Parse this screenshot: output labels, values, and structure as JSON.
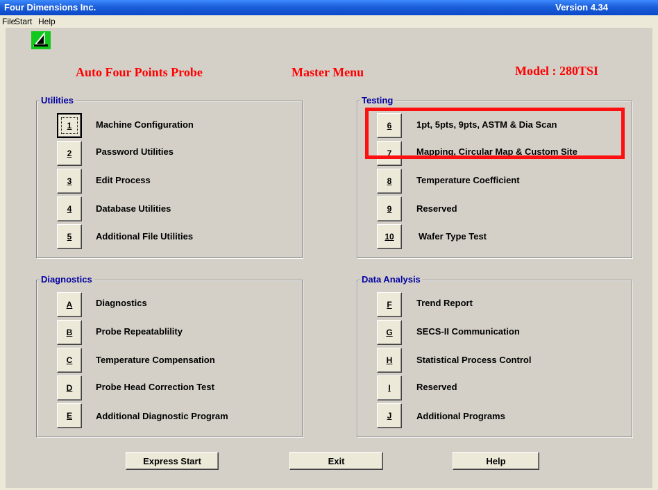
{
  "window": {
    "title": "Four Dimensions Inc.",
    "version": "Version 4.34"
  },
  "menu": [
    "File",
    "Start",
    "Help"
  ],
  "header": {
    "app_name": "Auto Four Points Probe",
    "menu_title": "Master Menu",
    "model": "Model : 280TSI"
  },
  "groups": {
    "utilities": {
      "title": "Utilities",
      "items": [
        {
          "key": "1",
          "label": "Machine Configuration"
        },
        {
          "key": "2",
          "label": "Password Utilities"
        },
        {
          "key": "3",
          "label": "Edit Process"
        },
        {
          "key": "4",
          "label": "Database Utilities"
        },
        {
          "key": "5",
          "label": "Additional File Utilities"
        }
      ]
    },
    "testing": {
      "title": "Testing",
      "items": [
        {
          "key": "6",
          "label": "1pt, 5pts, 9pts, ASTM & Dia Scan"
        },
        {
          "key": "7",
          "label": "Mapping, Circular Map & Custom Site"
        },
        {
          "key": "8",
          "label": "Temperature Coefficient"
        },
        {
          "key": "9",
          "label": "Reserved"
        },
        {
          "key": "10",
          "label": "Wafer Type Test"
        }
      ]
    },
    "diagnostics": {
      "title": "Diagnostics",
      "items": [
        {
          "key": "A",
          "label": "Diagnostics"
        },
        {
          "key": "B",
          "label": "Probe Repeatablility"
        },
        {
          "key": "C",
          "label": "Temperature Compensation"
        },
        {
          "key": "D",
          "label": "Probe Head Correction Test"
        },
        {
          "key": "E",
          "label": "Additional Diagnostic Program"
        }
      ]
    },
    "data_analysis": {
      "title": "Data Analysis",
      "items": [
        {
          "key": "F",
          "label": "Trend Report"
        },
        {
          "key": "G",
          "label": "SECS-II Communication"
        },
        {
          "key": "H",
          "label": "Statistical Process Control"
        },
        {
          "key": "I",
          "label": "Reserved"
        },
        {
          "key": "J",
          "label": "Additional Programs"
        }
      ]
    }
  },
  "buttons": {
    "express_start": "Express Start",
    "exit": "Exit",
    "help": "Help"
  },
  "colors": {
    "title_bar": "#0a48c8",
    "header_text": "#ff0000",
    "group_title": "#0000a0",
    "highlight_box": "#ff1010",
    "logo": "#12c81c"
  }
}
